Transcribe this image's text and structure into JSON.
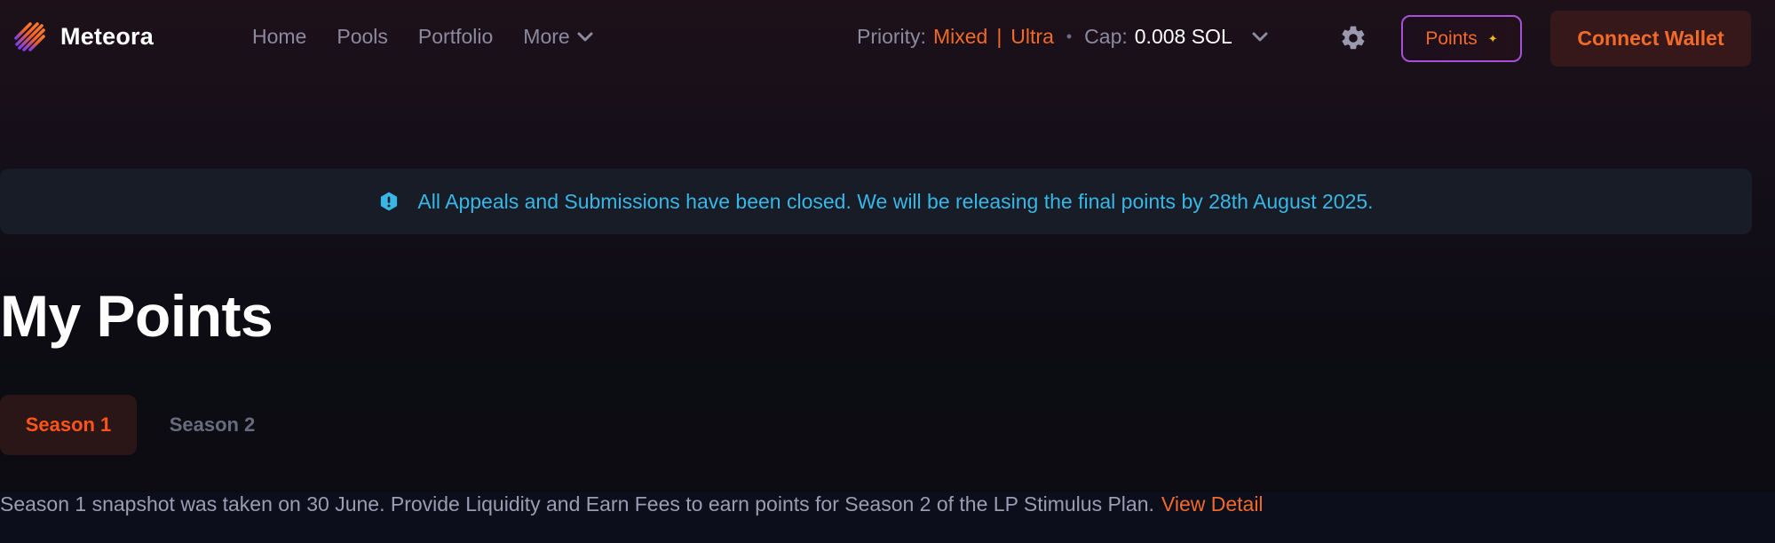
{
  "app": {
    "name": "Meteora"
  },
  "nav": {
    "links": [
      "Home",
      "Pools",
      "Portfolio"
    ],
    "more_label": "More"
  },
  "priority": {
    "label": "Priority:",
    "mode": "Mixed",
    "level": "Ultra",
    "cap_label": "Cap:",
    "cap_value": "0.008 SOL"
  },
  "points_button": {
    "label": "Points"
  },
  "connect_button": {
    "label": "Connect Wallet"
  },
  "banner": {
    "text": "All Appeals and Submissions have been closed. We will be releasing the final points by 28th August 2025."
  },
  "page": {
    "title": "My Points"
  },
  "tabs": [
    {
      "label": "Season 1",
      "active": true
    },
    {
      "label": "Season 2",
      "active": false
    }
  ],
  "snapshot": {
    "text": "Season 1 snapshot was taken on 30 June. Provide Liquidity and Earn Fees to earn points for Season 2 of the LP Stimulus Plan.",
    "link": "View Detail"
  },
  "colors": {
    "accent": "#f26a2a",
    "info": "#38b7e6",
    "background": "#0c0b12"
  },
  "icons": {
    "logo": "meteora-logo-icon",
    "more": "chevron-down-icon",
    "settings": "gear-icon",
    "banner": "info-icon",
    "points": "sparkle-icon"
  }
}
